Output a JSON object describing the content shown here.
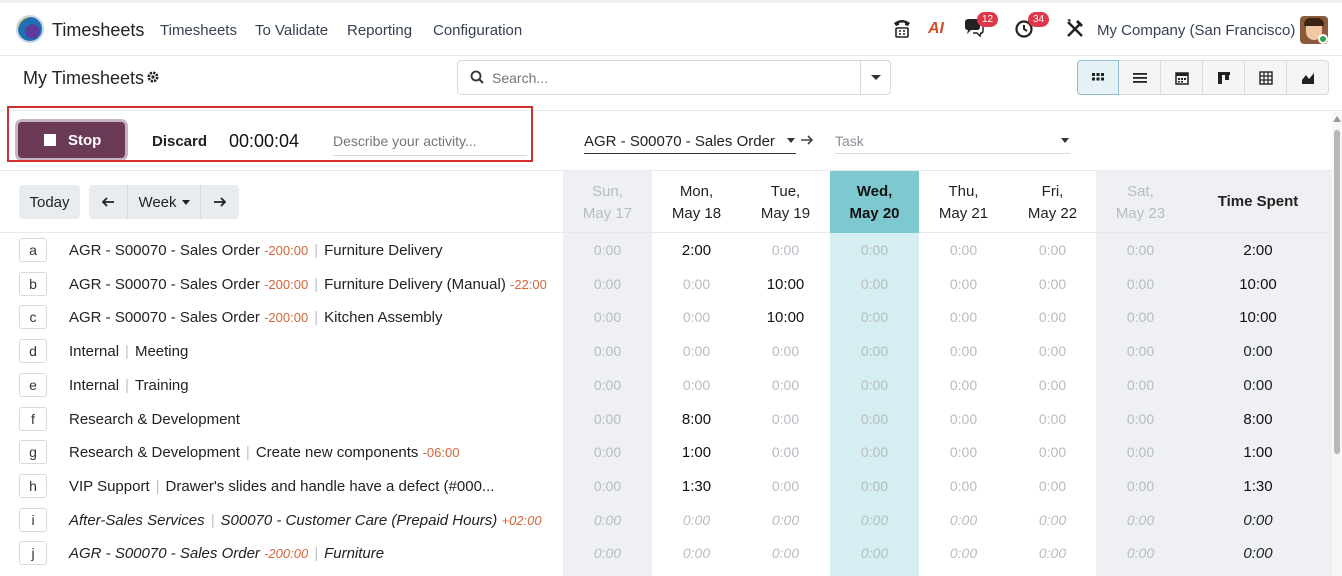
{
  "nav": {
    "app_name": "Timesheets",
    "menus": [
      "Timesheets",
      "To Validate",
      "Reporting",
      "Configuration"
    ],
    "chat_badge": "12",
    "activity_badge": "34",
    "company": "My Company (San Francisco)",
    "ai_label": "AI"
  },
  "control": {
    "title": "My Timesheets",
    "search_placeholder": "Search..."
  },
  "timer": {
    "stop_label": "Stop",
    "discard_label": "Discard",
    "elapsed": "00:00:04",
    "activity_placeholder": "Describe your activity...",
    "project": "AGR - S00070 - Sales Order",
    "task_placeholder": "Task"
  },
  "grid": {
    "today_label": "Today",
    "week_label": "Week",
    "days": [
      {
        "dow": "Sun,",
        "date": "May 17"
      },
      {
        "dow": "Mon,",
        "date": "May 18"
      },
      {
        "dow": "Tue,",
        "date": "May 19"
      },
      {
        "dow": "Wed,",
        "date": "May 20"
      },
      {
        "dow": "Thu,",
        "date": "May 21"
      },
      {
        "dow": "Fri,",
        "date": "May 22"
      },
      {
        "dow": "Sat,",
        "date": "May 23"
      }
    ],
    "time_spent_label": "Time Spent",
    "rows": [
      {
        "key": "a",
        "project": "AGR - S00070 - Sales Order",
        "project_hours": "-200:00",
        "task": "Furniture Delivery",
        "task_hours": "",
        "cells": [
          "0:00",
          "2:00",
          "0:00",
          "0:00",
          "0:00",
          "0:00",
          "0:00"
        ],
        "total": "2:00",
        "italic": false
      },
      {
        "key": "b",
        "project": "AGR - S00070 - Sales Order",
        "project_hours": "-200:00",
        "task": "Furniture Delivery (Manual)",
        "task_hours": "-22:00",
        "cells": [
          "0:00",
          "0:00",
          "10:00",
          "0:00",
          "0:00",
          "0:00",
          "0:00"
        ],
        "total": "10:00",
        "italic": false
      },
      {
        "key": "c",
        "project": "AGR - S00070 - Sales Order",
        "project_hours": "-200:00",
        "task": "Kitchen Assembly",
        "task_hours": "",
        "cells": [
          "0:00",
          "0:00",
          "10:00",
          "0:00",
          "0:00",
          "0:00",
          "0:00"
        ],
        "total": "10:00",
        "italic": false
      },
      {
        "key": "d",
        "project": "Internal",
        "project_hours": "",
        "task": "Meeting",
        "task_hours": "",
        "cells": [
          "0:00",
          "0:00",
          "0:00",
          "0:00",
          "0:00",
          "0:00",
          "0:00"
        ],
        "total": "0:00",
        "italic": false
      },
      {
        "key": "e",
        "project": "Internal",
        "project_hours": "",
        "task": "Training",
        "task_hours": "",
        "cells": [
          "0:00",
          "0:00",
          "0:00",
          "0:00",
          "0:00",
          "0:00",
          "0:00"
        ],
        "total": "0:00",
        "italic": false
      },
      {
        "key": "f",
        "project": "Research & Development",
        "project_hours": "",
        "task": "",
        "task_hours": "",
        "cells": [
          "0:00",
          "8:00",
          "0:00",
          "0:00",
          "0:00",
          "0:00",
          "0:00"
        ],
        "total": "8:00",
        "italic": false
      },
      {
        "key": "g",
        "project": "Research & Development",
        "project_hours": "",
        "task": "Create new components",
        "task_hours": "-06:00",
        "cells": [
          "0:00",
          "1:00",
          "0:00",
          "0:00",
          "0:00",
          "0:00",
          "0:00"
        ],
        "total": "1:00",
        "italic": false
      },
      {
        "key": "h",
        "project": "VIP Support",
        "project_hours": "",
        "task": "Drawer's slides and handle have a defect (#000...",
        "task_hours": "",
        "cells": [
          "0:00",
          "1:30",
          "0:00",
          "0:00",
          "0:00",
          "0:00",
          "0:00"
        ],
        "total": "1:30",
        "italic": false
      },
      {
        "key": "i",
        "project": "After-Sales Services",
        "project_hours": "",
        "task": "S00070 - Customer Care (Prepaid Hours)",
        "task_hours": "+02:00",
        "cells": [
          "0:00",
          "0:00",
          "0:00",
          "0:00",
          "0:00",
          "0:00",
          "0:00"
        ],
        "total": "0:00",
        "italic": true
      },
      {
        "key": "j",
        "project": "AGR - S00070 - Sales Order",
        "project_hours": "-200:00",
        "task": "Furniture",
        "task_hours": "",
        "cells": [
          "0:00",
          "0:00",
          "0:00",
          "0:00",
          "0:00",
          "0:00",
          "0:00"
        ],
        "total": "0:00",
        "italic": true
      }
    ]
  },
  "colors": {
    "accent": "#6b3a57",
    "today_header": "#7ec8d0",
    "today_col": "#d4eef1",
    "weekend_col": "#eef0f3",
    "highlight": "#d32f2f"
  }
}
